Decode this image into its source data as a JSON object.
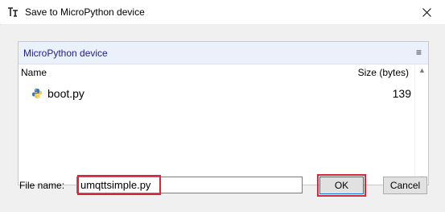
{
  "window": {
    "title": "Save to MicroPython device",
    "icon": "thonny-icon",
    "close_icon": "close-icon"
  },
  "browser": {
    "header_title": "MicroPython device",
    "menu_icon": "menu-icon",
    "menu_glyph": "≡",
    "columns": {
      "name": "Name",
      "size": "Size (bytes)"
    },
    "files": [
      {
        "icon": "python-file-icon",
        "name": "boot.py",
        "size": "139"
      }
    ]
  },
  "footer": {
    "file_name_label": "File name:",
    "file_name_value": "umqttsimple.py",
    "ok_label": "OK",
    "cancel_label": "Cancel"
  },
  "colors": {
    "highlight": "#d6283a",
    "header_text": "#1d1d8c",
    "panel_header_bg": "#eaf1fb",
    "dialog_bg": "#f0f0f0",
    "focus_border": "#0078d7"
  }
}
